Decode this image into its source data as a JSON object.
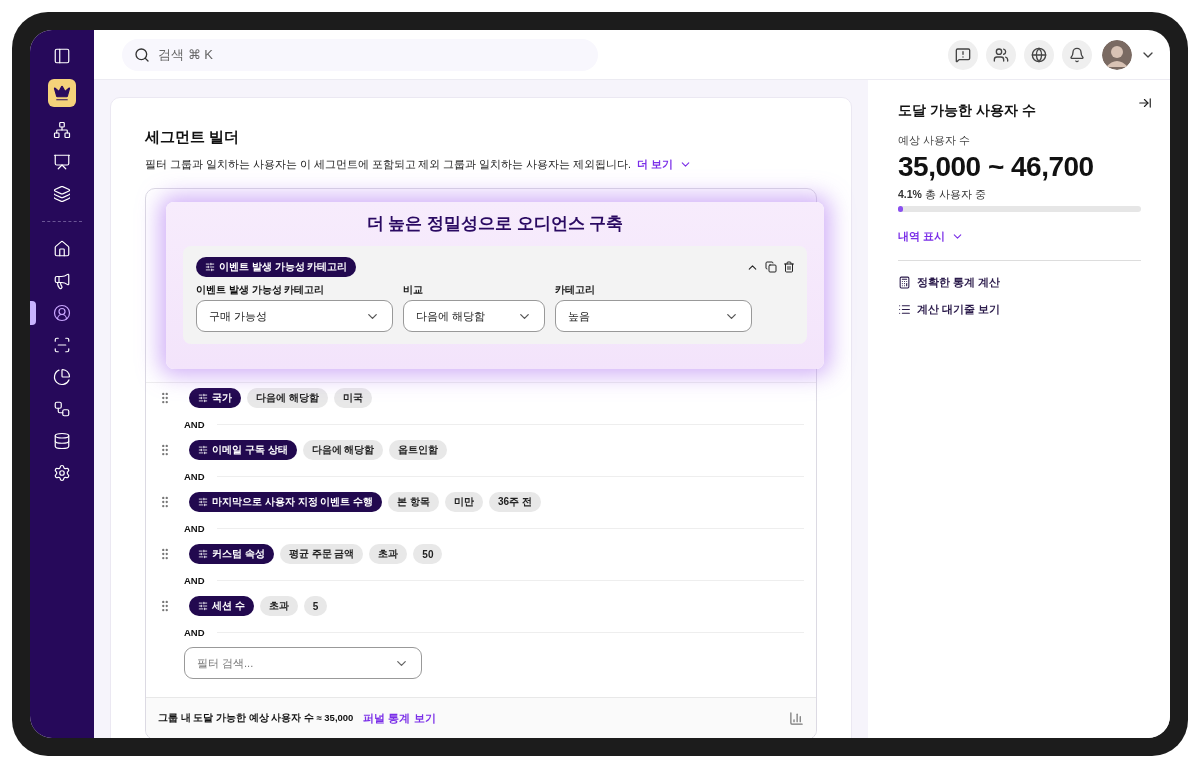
{
  "sidebar": {
    "items": [
      {
        "selected": false
      },
      {
        "selected": false
      },
      {
        "selected": false
      },
      {
        "selected": false
      },
      {
        "selected": false
      },
      {
        "selected": false
      },
      {
        "selected": true
      },
      {
        "selected": false
      },
      {
        "selected": false
      },
      {
        "selected": false
      },
      {
        "selected": false
      },
      {
        "selected": false
      }
    ]
  },
  "search": {
    "placeholder": "검색 ⌘ K"
  },
  "segment_builder": {
    "title": "세그먼트 빌더",
    "description": "필터 그룹과 일치하는 사용자는 이 세그먼트에 포함되고 제외 그룹과 일치하는 사용자는 제외됩니다.",
    "more_link": "더 보기"
  },
  "overlay": {
    "title": "더 높은 정밀성으로 오디언스 구축",
    "chip": "이벤트 발생 가능성 카테고리",
    "fields": [
      {
        "label": "이벤트 발생 가능성 카테고리",
        "value": "구매 가능성"
      },
      {
        "label": "비교",
        "value": "다음에 해당함"
      },
      {
        "label": "카테고리",
        "value": "높음"
      }
    ]
  },
  "filters": [
    {
      "chip": "국가",
      "values": [
        "다음에 해당함",
        "미국"
      ],
      "connector": "AND"
    },
    {
      "chip": "이메일 구독 상태",
      "values": [
        "다음에 해당함",
        "옵트인함"
      ],
      "connector": "AND"
    },
    {
      "chip": "마지막으로 사용자 지정 이벤트 수행",
      "values": [
        "본 항목",
        "미만",
        "36주 전"
      ],
      "connector": "AND"
    },
    {
      "chip": "커스텀 속성",
      "values": [
        "평균 주문 금액",
        "초과",
        "50"
      ],
      "connector": "AND"
    },
    {
      "chip": "세션 수",
      "values": [
        "초과",
        "5"
      ],
      "connector": "AND"
    }
  ],
  "filter_search": {
    "placeholder": "필터 검색..."
  },
  "footer": {
    "text": "그룹 내 도달 가능한 예상 사용자 수 ≈ 35,000",
    "link": "퍼널 통계 보기"
  },
  "reach": {
    "title": "도달 가능한 사용자 수",
    "subtitle": "예상 사용자 수",
    "range": "35,000 ~ 46,700",
    "share": "**4.1%** 총 사용자 중",
    "level": 0.02,
    "breakdown": "내역 표시",
    "actions": [
      "정확한 통계 계산",
      "계산 대기줄 보기"
    ]
  }
}
